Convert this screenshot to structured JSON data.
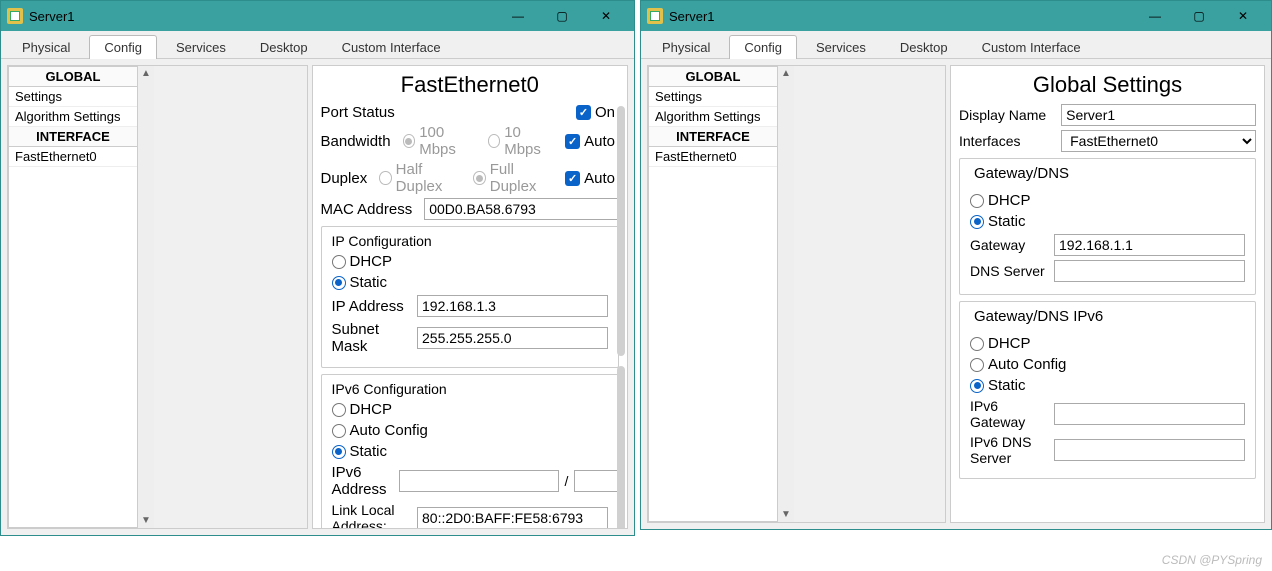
{
  "window": {
    "title": "Server1",
    "controls": {
      "min": "—",
      "max": "▢",
      "close": "✕"
    }
  },
  "tabs": [
    "Physical",
    "Config",
    "Services",
    "Desktop",
    "Custom Interface"
  ],
  "sidebar": {
    "global_header": "GLOBAL",
    "global_items": [
      "Settings",
      "Algorithm Settings"
    ],
    "iface_header": "INTERFACE",
    "iface_items": [
      "FastEthernet0"
    ]
  },
  "left": {
    "panel_title": "FastEthernet0",
    "port_status_label": "Port Status",
    "on_label": "On",
    "bandwidth_label": "Bandwidth",
    "bw_100": "100 Mbps",
    "bw_10": "10 Mbps",
    "auto_label": "Auto",
    "duplex_label": "Duplex",
    "half_duplex": "Half Duplex",
    "full_duplex": "Full Duplex",
    "mac_label": "MAC Address",
    "mac_value": "00D0.BA58.6793",
    "ipcfg_title": "IP Configuration",
    "dhcp": "DHCP",
    "static": "Static",
    "ip_label": "IP Address",
    "ip_value": "192.168.1.3",
    "mask_label": "Subnet Mask",
    "mask_value": "255.255.255.0",
    "ip6cfg_title": "IPv6 Configuration",
    "autocfg": "Auto Config",
    "ip6_label": "IPv6 Address",
    "ip6_value": "",
    "ip6_prefix": "",
    "linklocal_label": "Link Local Address:",
    "linklocal_value": "80::2D0:BAFF:FE58:6793"
  },
  "right": {
    "panel_title": "Global Settings",
    "display_name_label": "Display Name",
    "display_name_value": "Server1",
    "ifaces_label": "Interfaces",
    "ifaces_value": "FastEthernet0",
    "gw_title": "Gateway/DNS",
    "dhcp": "DHCP",
    "static": "Static",
    "gateway_label": "Gateway",
    "gateway_value": "192.168.1.1",
    "dns_label": "DNS Server",
    "dns_value": "",
    "gw6_title": "Gateway/DNS IPv6",
    "autocfg": "Auto Config",
    "ip6gw_label": "IPv6 Gateway",
    "ip6gw_value": "",
    "ip6dns_label": "IPv6 DNS Server",
    "ip6dns_value": ""
  },
  "watermark": "CSDN @PYSpring"
}
